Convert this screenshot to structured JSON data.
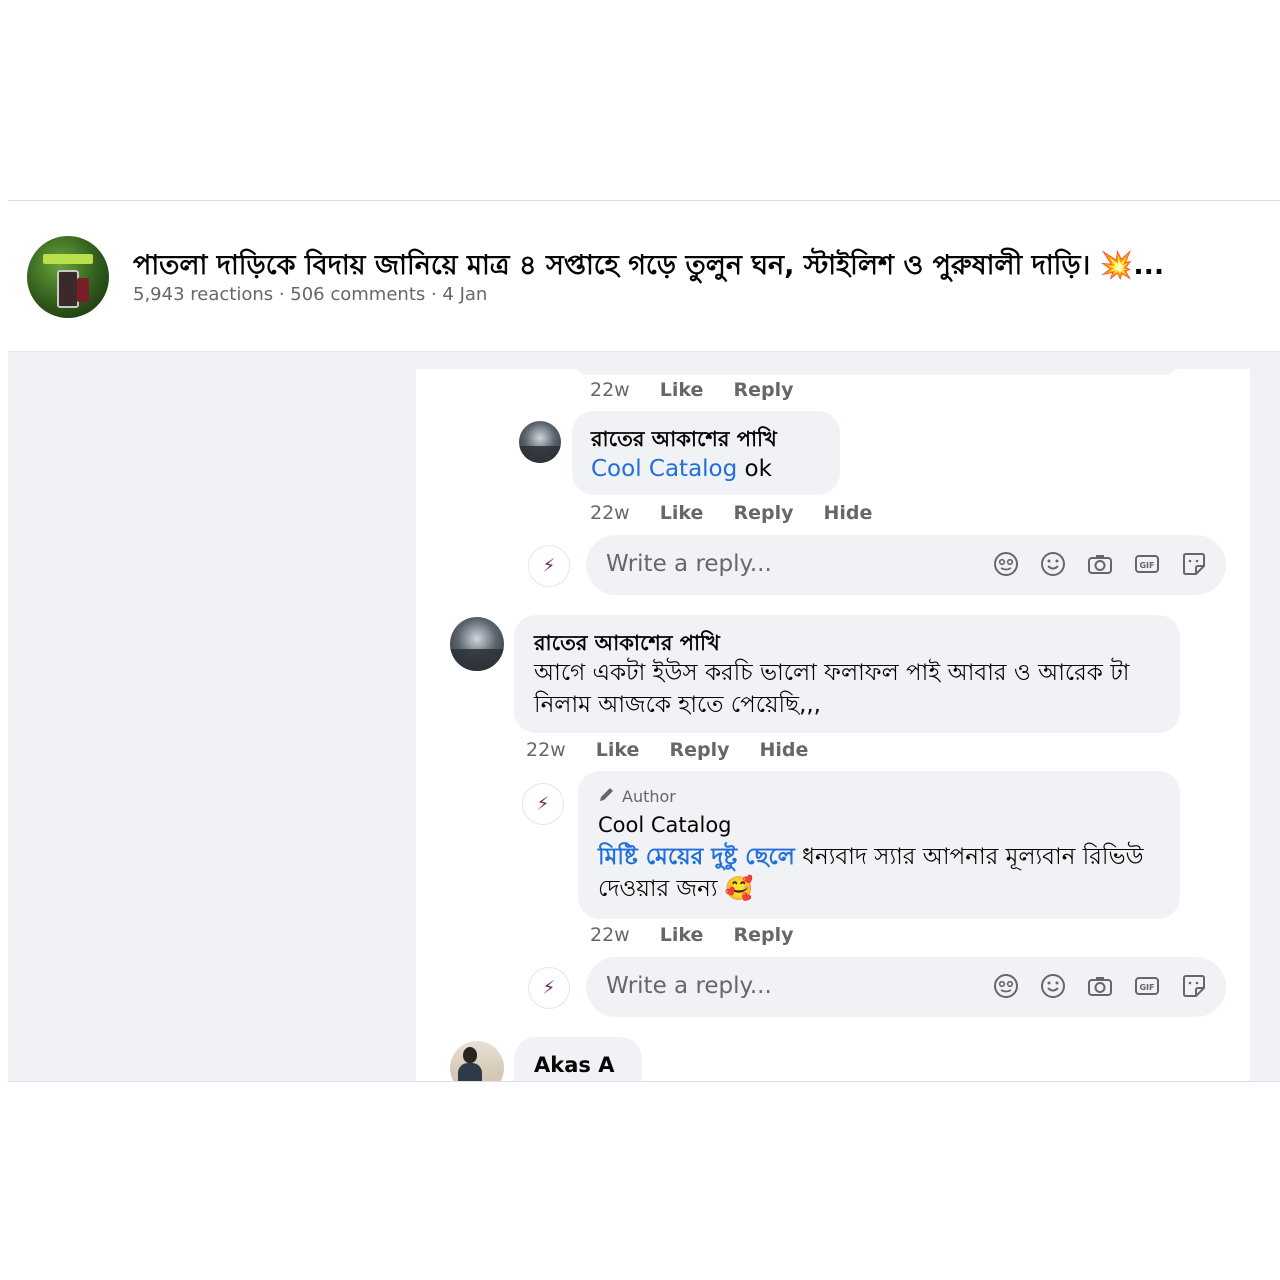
{
  "post": {
    "title": "পাতলা দাড়িকে বিদায় জানিয়ে মাত্র ৪ সপ্তাহে গড়ে তুলুন ঘন, স্টাইলিশ ও পুরুষালী দাড়ি। 💥...",
    "meta": "5,943 reactions · 506 comments · 4 Jan"
  },
  "thread_top_actions": {
    "time": "22w",
    "like": "Like",
    "reply": "Reply"
  },
  "comment1": {
    "author": "রাতের আকাশের পাখি",
    "tag": "Cool Catalog",
    "text": " ok",
    "time": "22w",
    "like": "Like",
    "reply": "Reply",
    "hide": "Hide"
  },
  "reply_box_1": {
    "placeholder": "Write a reply..."
  },
  "comment2": {
    "author": "রাতের আকাশের পাখি",
    "text": "আগে একটা ইউস করচি ভালো ফলাফল পাই আবার ও আরেক টা নিলাম আজকে হাতে পেয়েছি,,,",
    "time": "22w",
    "like": "Like",
    "reply": "Reply",
    "hide": "Hide"
  },
  "comment3": {
    "badge": "Author",
    "author": "Cool Catalog",
    "tag": "মিষ্টি মেয়ের দুষ্টু ছেলে",
    "text": " ধন্যবাদ স্যার আপনার মূল্যবান রিভিউ দেওয়ার জন্য 🥰",
    "time": "22w",
    "like": "Like",
    "reply": "Reply"
  },
  "reply_box_2": {
    "placeholder": "Write a reply..."
  },
  "comment4": {
    "author": "Akas A"
  },
  "icons": [
    "avatar-sticker-icon",
    "emoji-icon",
    "camera-icon",
    "gif-icon",
    "sticker-icon"
  ]
}
